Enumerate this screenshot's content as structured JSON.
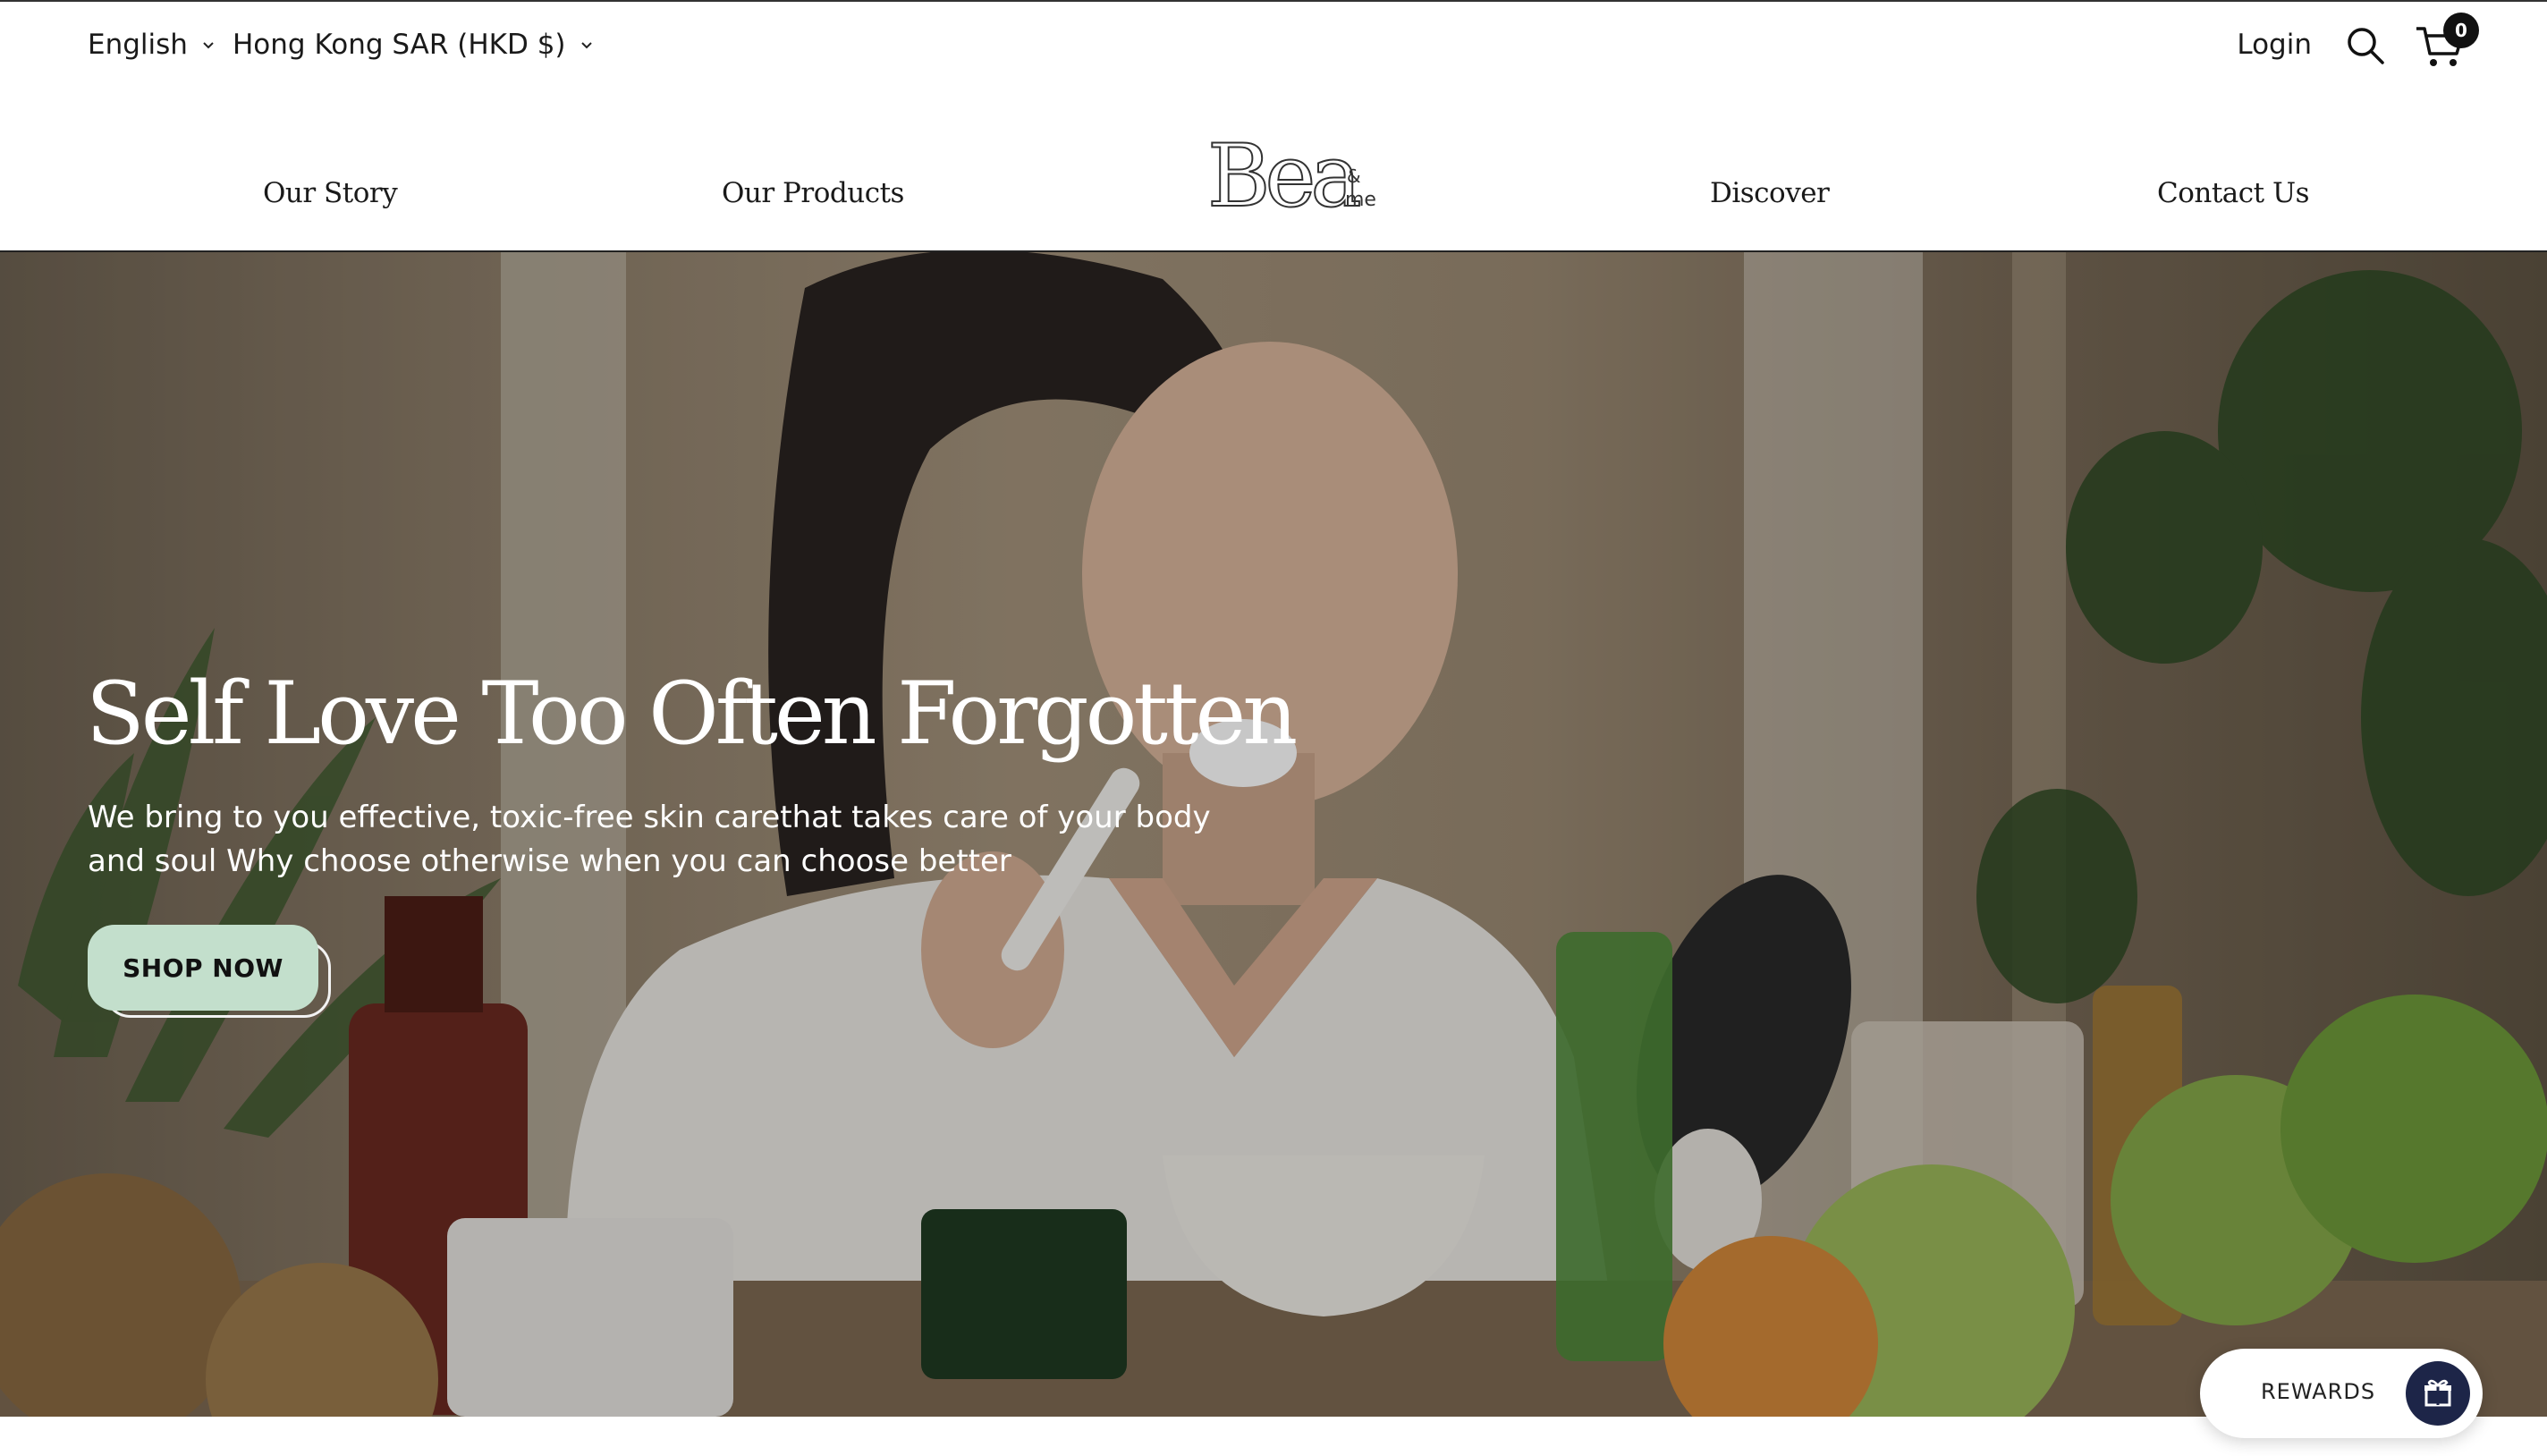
{
  "utility": {
    "language": "English",
    "currency": "Hong Kong SAR (HKD $)",
    "login": "Login",
    "cart_count": "0"
  },
  "brand": {
    "name": "Bea",
    "suffix_amp": "&",
    "suffix_me": "me"
  },
  "nav": {
    "our_story": "Our Story",
    "our_products": "Our Products",
    "discover": "Discover",
    "contact_us": "Contact Us"
  },
  "hero": {
    "title": "Self Love Too Often Forgotten",
    "subtitle": "We bring to you effective, toxic-free skin carethat takes care of your body and soul Why choose otherwise when you can choose better",
    "cta": "SHOP NOW"
  },
  "rewards": {
    "label": "REWARDS"
  },
  "colors": {
    "cta_background": "#c3dfcc",
    "rewards_icon_background": "#1d2548",
    "cart_badge": "#111111"
  },
  "icons": [
    "chevron-down-icon",
    "search-icon",
    "cart-icon",
    "gift-icon"
  ]
}
